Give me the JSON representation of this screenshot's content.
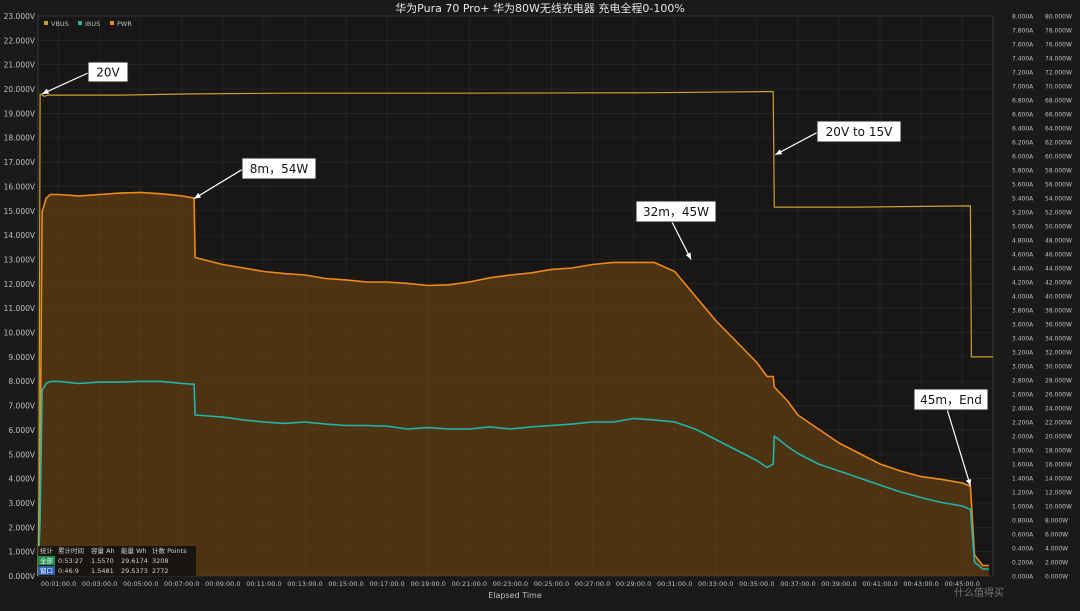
{
  "colors": {
    "background": "#1a1a1a",
    "plot_background": "#181716",
    "vbus": "#c9a227",
    "ibus": "#1fb5ad",
    "pwr": "#f08a16",
    "pwr_fill": "#7a4a10",
    "grid": "#2b2b2b",
    "axis_text": "#bfbfbf",
    "annotation_bg": "#ffffff",
    "annotation_text": "#111111"
  },
  "chart_data": {
    "type": "line",
    "title": "华为Pura 70 Pro+ 华为80W无线充电器 充电全程0-100%",
    "xlabel": "Elapsed Time",
    "x_unit": "minutes",
    "xlim": [
      0,
      46.5
    ],
    "x_ticks": [
      "00:01:00.0",
      "00:03:00.0",
      "00:05:00.0",
      "00:07:00.0",
      "00:09:00.0",
      "00:11:00.0",
      "00:13:00.0",
      "00:15:00.0",
      "00:17:00.0",
      "00:19:00.0",
      "00:21:00.0",
      "00:23:00.0",
      "00:25:00.0",
      "00:27:00.0",
      "00:29:00.0",
      "00:31:00.0",
      "00:33:00.0",
      "00:35:00.0",
      "00:37:00.0",
      "00:39:00.0",
      "00:41:00.0",
      "00:43:00.0",
      "00:45:00.0"
    ],
    "y_left": {
      "ylim": [
        0,
        23
      ],
      "ticks": [
        "0.000V",
        "1.000V",
        "2.000V",
        "3.000V",
        "4.000V",
        "5.000V",
        "6.000V",
        "7.000V",
        "8.000V",
        "9.000V",
        "10.000V",
        "11.000V",
        "12.000V",
        "13.000V",
        "14.000V",
        "15.000V",
        "16.000V",
        "17.000V",
        "18.000V",
        "19.000V",
        "20.000V",
        "21.000V",
        "22.000V",
        "23.000V"
      ]
    },
    "y_right_current": {
      "ylim": [
        0,
        8
      ],
      "ticks": [
        "0.000A",
        "0.200A",
        "0.400A",
        "0.600A",
        "0.800A",
        "1.000A",
        "1.200A",
        "1.400A",
        "1.600A",
        "1.800A",
        "2.000A",
        "2.200A",
        "2.400A",
        "2.600A",
        "2.800A",
        "3.000A",
        "3.200A",
        "3.400A",
        "3.600A",
        "3.800A",
        "4.000A",
        "4.200A",
        "4.400A",
        "4.600A",
        "4.800A",
        "5.000A",
        "5.200A",
        "5.400A",
        "5.600A",
        "5.800A",
        "6.000A",
        "6.200A",
        "6.400A",
        "6.600A",
        "6.800A",
        "7.000A",
        "7.200A",
        "7.400A",
        "7.600A",
        "7.800A",
        "8.000A"
      ]
    },
    "y_right_power": {
      "ylim": [
        0,
        80
      ],
      "ticks": [
        "0.000W",
        "2.000W",
        "4.000W",
        "6.000W",
        "8.000W",
        "10.000W",
        "12.000W",
        "14.000W",
        "16.000W",
        "18.000W",
        "20.000W",
        "22.000W",
        "24.000W",
        "26.000W",
        "28.000W",
        "30.000W",
        "32.000W",
        "34.000W",
        "36.000W",
        "38.000W",
        "40.000W",
        "42.000W",
        "44.000W",
        "46.000W",
        "48.000W",
        "50.000W",
        "52.000W",
        "54.000W",
        "56.000W",
        "58.000W",
        "60.000W",
        "62.000W",
        "64.000W",
        "66.000W",
        "68.000W",
        "70.000W",
        "72.000W",
        "74.000W",
        "76.000W",
        "78.000W",
        "80.000W"
      ]
    },
    "legend": [
      "VBUS",
      "IBUS",
      "PWR"
    ],
    "legend_position": "top-left",
    "series": [
      {
        "name": "VBUS",
        "axis": "left_V",
        "x": [
          0,
          0.05,
          0.1,
          0.3,
          0.5,
          1,
          4,
          7.5,
          12,
          20,
          30,
          35.8,
          35.85,
          36.5,
          40,
          45.4,
          45.45,
          46.5
        ],
        "y": [
          0,
          3.5,
          19.8,
          19.7,
          19.75,
          19.75,
          19.75,
          19.8,
          19.83,
          19.83,
          19.85,
          19.9,
          15.15,
          15.15,
          15.15,
          15.2,
          9.0,
          9.0
        ]
      },
      {
        "name": "IBUS",
        "axis": "right_A",
        "x": [
          0,
          0.1,
          0.2,
          0.4,
          0.6,
          1,
          2,
          3,
          4,
          5,
          6,
          7,
          7.6,
          7.65,
          9,
          10,
          11,
          12,
          13,
          14,
          15,
          16,
          17,
          18,
          19,
          20,
          21,
          22,
          23,
          24,
          25,
          26,
          27,
          28,
          29,
          30,
          31,
          32,
          33,
          34,
          35,
          35.5,
          35.8,
          35.85,
          36.5,
          37,
          38,
          39,
          40,
          41,
          42,
          43,
          44,
          45,
          45.4,
          45.6,
          46,
          46.3
        ],
        "y": [
          0,
          0.8,
          2.65,
          2.75,
          2.78,
          2.78,
          2.75,
          2.77,
          2.77,
          2.78,
          2.78,
          2.75,
          2.74,
          2.3,
          2.27,
          2.23,
          2.2,
          2.18,
          2.2,
          2.17,
          2.15,
          2.15,
          2.14,
          2.1,
          2.12,
          2.1,
          2.1,
          2.13,
          2.1,
          2.13,
          2.15,
          2.17,
          2.2,
          2.2,
          2.25,
          2.23,
          2.2,
          2.1,
          1.95,
          1.8,
          1.65,
          1.55,
          1.6,
          2.0,
          1.85,
          1.75,
          1.6,
          1.5,
          1.4,
          1.3,
          1.2,
          1.12,
          1.05,
          1.0,
          0.95,
          0.2,
          0.1,
          0.1
        ]
      },
      {
        "name": "PWR",
        "axis": "right_W",
        "x": [
          0,
          0.1,
          0.2,
          0.4,
          0.6,
          1,
          2,
          3,
          4,
          5,
          6,
          7,
          7.6,
          7.65,
          9,
          10,
          11,
          12,
          13,
          14,
          15,
          16,
          17,
          18,
          19,
          20,
          21,
          22,
          23,
          24,
          25,
          26,
          27,
          28,
          29,
          30,
          31,
          32,
          33,
          34,
          35,
          35.5,
          35.8,
          35.85,
          36.5,
          37,
          38,
          39,
          40,
          41,
          42,
          43,
          44,
          45,
          45.4,
          45.6,
          46,
          46.3
        ],
        "y": [
          0,
          15,
          52,
          54,
          54.5,
          54.5,
          54.3,
          54.5,
          54.7,
          54.8,
          54.6,
          54.3,
          54.0,
          45.5,
          44.5,
          44.0,
          43.5,
          43.2,
          43.0,
          42.5,
          42.3,
          42.0,
          42.0,
          41.8,
          41.5,
          41.6,
          42.0,
          42.6,
          43.0,
          43.3,
          43.8,
          44.0,
          44.5,
          44.8,
          44.8,
          44.8,
          43.5,
          40.0,
          36.5,
          33.5,
          30.5,
          28.5,
          28.5,
          27.0,
          25.0,
          23.0,
          21.0,
          19.0,
          17.5,
          16.0,
          15.0,
          14.2,
          13.8,
          13.3,
          12.8,
          3.0,
          1.5,
          1.5
        ]
      }
    ],
    "annotations": [
      {
        "text": "20V",
        "x": 0.2,
        "y": 19.8
      },
      {
        "text": "8m，54W",
        "x": 7.6,
        "y": 15.5
      },
      {
        "text": "20V to 15V",
        "x": 35.9,
        "y": 17.3
      },
      {
        "text": "32m，45W",
        "x": 31.8,
        "y": 13.0
      },
      {
        "text": "45m，End",
        "x": 45.4,
        "y": 3.7
      }
    ],
    "stats_table": {
      "headers": [
        "统计",
        "累计时间",
        "容量 Ah",
        "能量 Wh",
        "计数 Points"
      ],
      "rows": [
        [
          "全部",
          "0:53:27",
          "1.5570",
          "29.6174",
          "3208"
        ],
        [
          "窗口",
          "0:46:9",
          "1.5481",
          "29.5373",
          "2772"
        ]
      ]
    },
    "watermark": "什么值得买"
  }
}
